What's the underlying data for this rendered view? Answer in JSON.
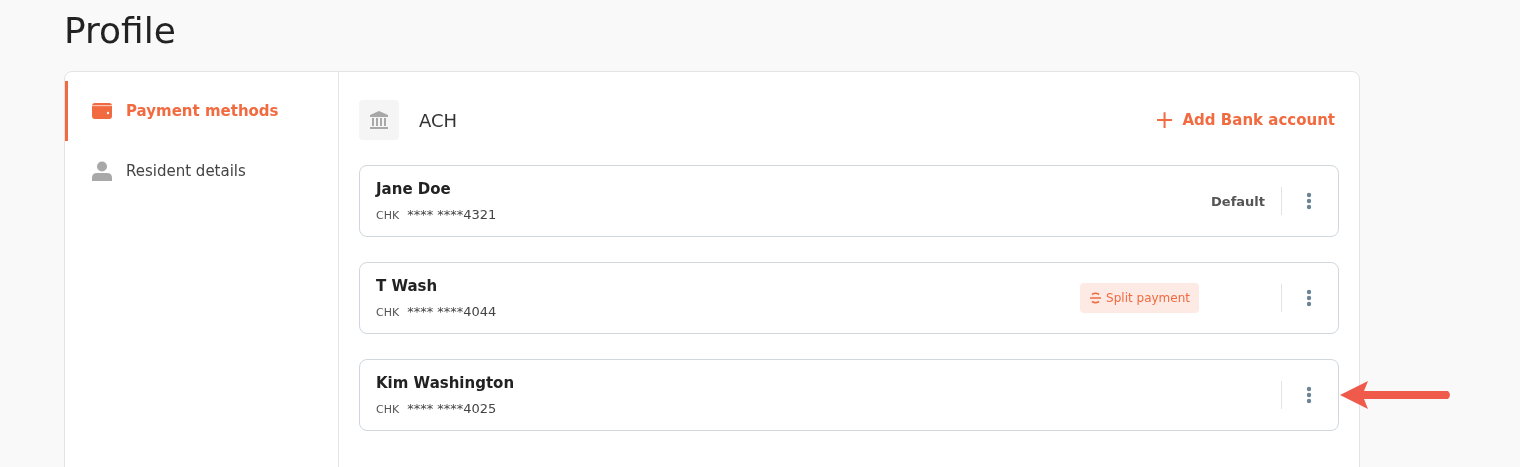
{
  "page": {
    "title": "Profile"
  },
  "sidebar": {
    "items": [
      {
        "label": "Payment methods",
        "kind": "wallet",
        "selected": true
      },
      {
        "label": "Resident details",
        "kind": "person",
        "selected": false
      }
    ]
  },
  "section": {
    "title": "ACH",
    "action": {
      "icon": "+",
      "label": "Add Bank account"
    }
  },
  "accounts": [
    {
      "name": "Jane Doe",
      "type": "CHK",
      "number": "**** ****4321",
      "tag": {
        "kind": "default",
        "label": "Default"
      }
    },
    {
      "name": "T Wash",
      "type": "CHK",
      "number": "**** ****4044",
      "tag": {
        "kind": "split",
        "label": "Split payment"
      }
    },
    {
      "name": "Kim Washington",
      "type": "CHK",
      "number": "**** ****4025",
      "highlighted": true
    }
  ]
}
